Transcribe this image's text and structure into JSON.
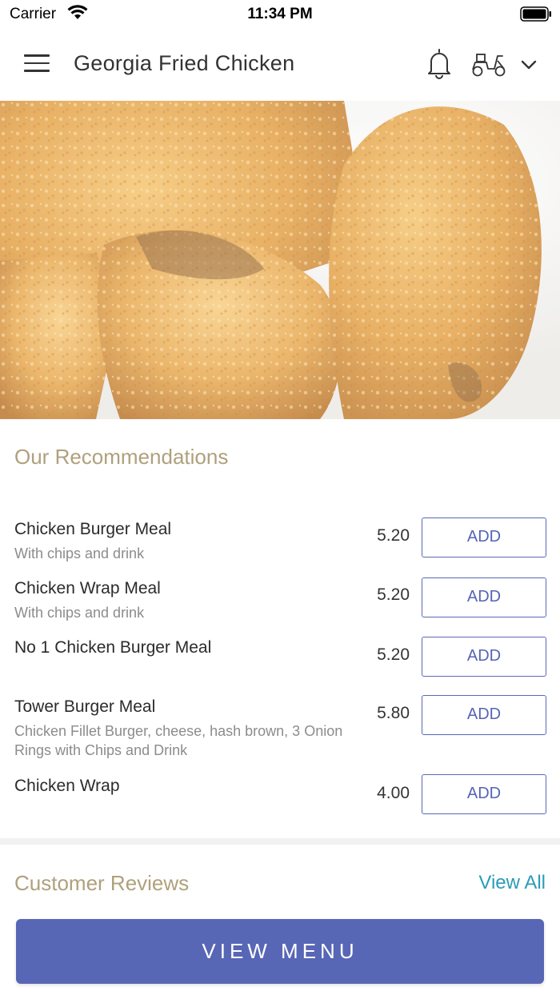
{
  "status_bar": {
    "carrier": "Carrier",
    "time": "11:34 PM"
  },
  "header": {
    "title": "Georgia Fried Chicken",
    "icons": [
      "menu-icon",
      "bell-icon",
      "scooter-icon",
      "chevron-down-icon"
    ]
  },
  "hero": {
    "icon": "fried-chicken-photo"
  },
  "recommendations": {
    "title": "Our Recommendations",
    "items": [
      {
        "name": "Chicken Burger Meal",
        "description": "With chips and drink",
        "price": "5.20",
        "button": "ADD"
      },
      {
        "name": "Chicken Wrap Meal",
        "description": "With chips and drink",
        "price": "5.20",
        "button": "ADD"
      },
      {
        "name": "No 1 Chicken Burger Meal",
        "description": "",
        "price": "5.20",
        "button": "ADD"
      },
      {
        "name": "Tower Burger Meal",
        "description": "Chicken Fillet Burger, cheese, hash brown, 3 Onion Rings with Chips and Drink",
        "price": "5.80",
        "button": "ADD"
      },
      {
        "name": "Chicken Wrap",
        "description": "",
        "price": "4.00",
        "button": "ADD"
      }
    ]
  },
  "reviews": {
    "title": "Customer Reviews",
    "view_all": "View All"
  },
  "footer": {
    "view_menu": "VIEW MENU"
  },
  "colors": {
    "accent": "#5866b6",
    "section_title": "#b0a07c",
    "link": "#2a9cb8"
  }
}
